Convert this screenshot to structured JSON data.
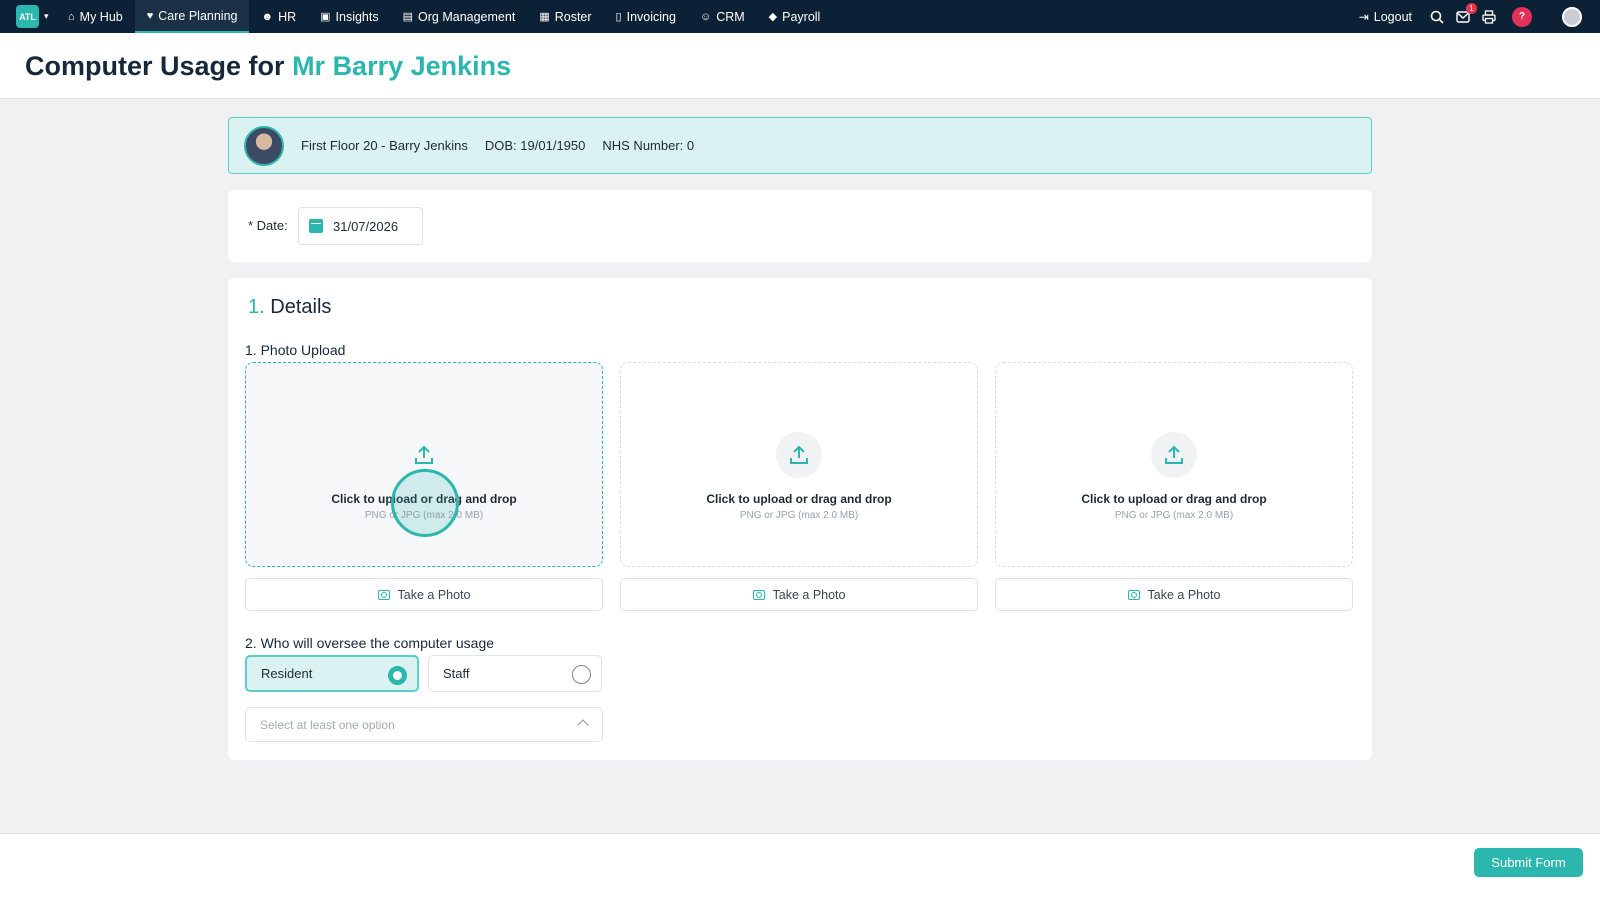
{
  "nav": {
    "brand": "ATL",
    "items": [
      {
        "label": "My Hub",
        "icon": "home-icon",
        "glyph": "⌂"
      },
      {
        "label": "Care Planning",
        "icon": "heart-icon",
        "glyph": "♥"
      },
      {
        "label": "HR",
        "icon": "people-icon",
        "glyph": "☻"
      },
      {
        "label": "Insights",
        "icon": "chart-icon",
        "glyph": "▣"
      },
      {
        "label": "Org Management",
        "icon": "building-icon",
        "glyph": "▤"
      },
      {
        "label": "Roster",
        "icon": "calendar-icon",
        "glyph": "▦"
      },
      {
        "label": "Invoicing",
        "icon": "document-icon",
        "glyph": "▯"
      },
      {
        "label": "CRM",
        "icon": "users-icon",
        "glyph": "☺"
      },
      {
        "label": "Payroll",
        "icon": "tag-icon",
        "glyph": "◆"
      }
    ],
    "logout": "Logout",
    "notification_count": "1",
    "help": "?"
  },
  "page": {
    "title_prefix": "Computer Usage for",
    "title_name": "Mr Barry Jenkins"
  },
  "resident": {
    "location_name": "First Floor 20 - Barry Jenkins",
    "dob_label": "DOB:",
    "dob": "19/01/1950",
    "nhs_label": "NHS Number:",
    "nhs": "0"
  },
  "date_field": {
    "label": "* Date:",
    "value": "31/07/2026"
  },
  "details": {
    "section_number": "1.",
    "section_title": "Details",
    "q1_label": "1. Photo Upload",
    "upload_text": "Click to upload or drag and drop",
    "upload_sub": "PNG or JPG (max 2.0 MB)",
    "take_photo": "Take a Photo",
    "q2_label": "2. Who will oversee the computer usage",
    "options": [
      "Resident",
      "Staff"
    ],
    "selected_option": "Resident",
    "select_placeholder": "Select at least one option"
  },
  "footer": {
    "submit": "Submit Form"
  },
  "colors": {
    "accent": "#2bb7ad",
    "nav_bg": "#0d2136",
    "badge": "#e8334a"
  }
}
